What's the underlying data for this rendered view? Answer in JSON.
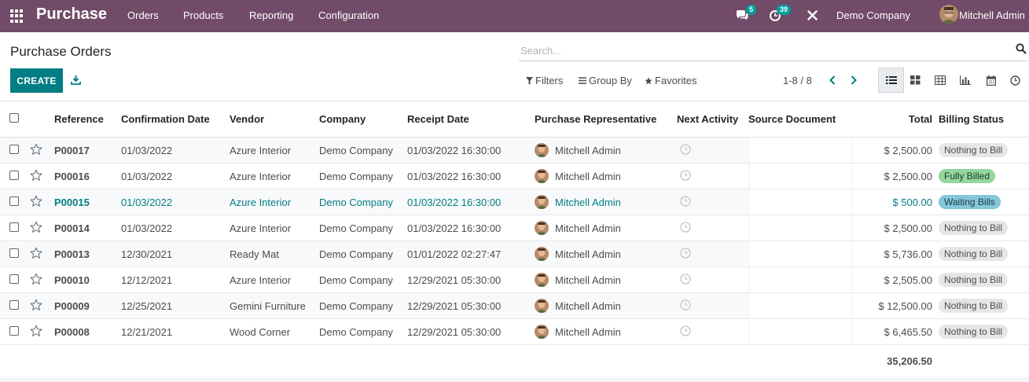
{
  "navbar": {
    "app_title": "Purchase",
    "menu": [
      "Orders",
      "Products",
      "Reporting",
      "Configuration"
    ],
    "messages_count": "5",
    "activities_count": "39",
    "company": "Demo Company",
    "user": "Mitchell Admin"
  },
  "control_panel": {
    "title": "Purchase Orders",
    "search_placeholder": "Search...",
    "create_label": "CREATE",
    "filters_label": "Filters",
    "group_by_label": "Group By",
    "favorites_label": "Favorites",
    "pager": "1-8 / 8"
  },
  "columns": {
    "reference": "Reference",
    "confirmation_date": "Confirmation Date",
    "vendor": "Vendor",
    "company": "Company",
    "receipt_date": "Receipt Date",
    "representative": "Purchase Representative",
    "next_activity": "Next Activity",
    "source_document": "Source Document",
    "total": "Total",
    "billing_status": "Billing Status"
  },
  "rows": [
    {
      "reference": "P00017",
      "confirmation_date": "01/03/2022",
      "vendor": "Azure Interior",
      "company": "Demo Company",
      "receipt_date": "01/03/2022 16:30:00",
      "representative": "Mitchell Admin",
      "total": "$ 2,500.00",
      "billing_status": "Nothing to Bill"
    },
    {
      "reference": "P00016",
      "confirmation_date": "01/03/2022",
      "vendor": "Azure Interior",
      "company": "Demo Company",
      "receipt_date": "01/03/2022 16:30:00",
      "representative": "Mitchell Admin",
      "total": "$ 2,500.00",
      "billing_status": "Fully Billed"
    },
    {
      "reference": "P00015",
      "confirmation_date": "01/03/2022",
      "vendor": "Azure Interior",
      "company": "Demo Company",
      "receipt_date": "01/03/2022 16:30:00",
      "representative": "Mitchell Admin",
      "total": "$ 500.00",
      "billing_status": "Waiting Bills"
    },
    {
      "reference": "P00014",
      "confirmation_date": "01/03/2022",
      "vendor": "Azure Interior",
      "company": "Demo Company",
      "receipt_date": "01/03/2022 16:30:00",
      "representative": "Mitchell Admin",
      "total": "$ 2,500.00",
      "billing_status": "Nothing to Bill"
    },
    {
      "reference": "P00013",
      "confirmation_date": "12/30/2021",
      "vendor": "Ready Mat",
      "company": "Demo Company",
      "receipt_date": "01/01/2022 02:27:47",
      "representative": "Mitchell Admin",
      "total": "$ 5,736.00",
      "billing_status": "Nothing to Bill"
    },
    {
      "reference": "P00010",
      "confirmation_date": "12/12/2021",
      "vendor": "Azure Interior",
      "company": "Demo Company",
      "receipt_date": "12/29/2021 05:30:00",
      "representative": "Mitchell Admin",
      "total": "$ 2,505.00",
      "billing_status": "Nothing to Bill"
    },
    {
      "reference": "P00009",
      "confirmation_date": "12/25/2021",
      "vendor": "Gemini Furniture",
      "company": "Demo Company",
      "receipt_date": "12/29/2021 05:30:00",
      "representative": "Mitchell Admin",
      "total": "$ 12,500.00",
      "billing_status": "Nothing to Bill"
    },
    {
      "reference": "P00008",
      "confirmation_date": "12/21/2021",
      "vendor": "Wood Corner",
      "company": "Demo Company",
      "receipt_date": "12/29/2021 05:30:00",
      "representative": "Mitchell Admin",
      "total": "$ 6,465.50",
      "billing_status": "Nothing to Bill"
    }
  ],
  "grand_total": "35,206.50",
  "colors": {
    "navbar": "#714b67",
    "primary": "#017e84",
    "fully_billed": "#95d59f",
    "waiting_bills": "#84c7d9",
    "nothing_to_bill": "#e6e6e6"
  }
}
